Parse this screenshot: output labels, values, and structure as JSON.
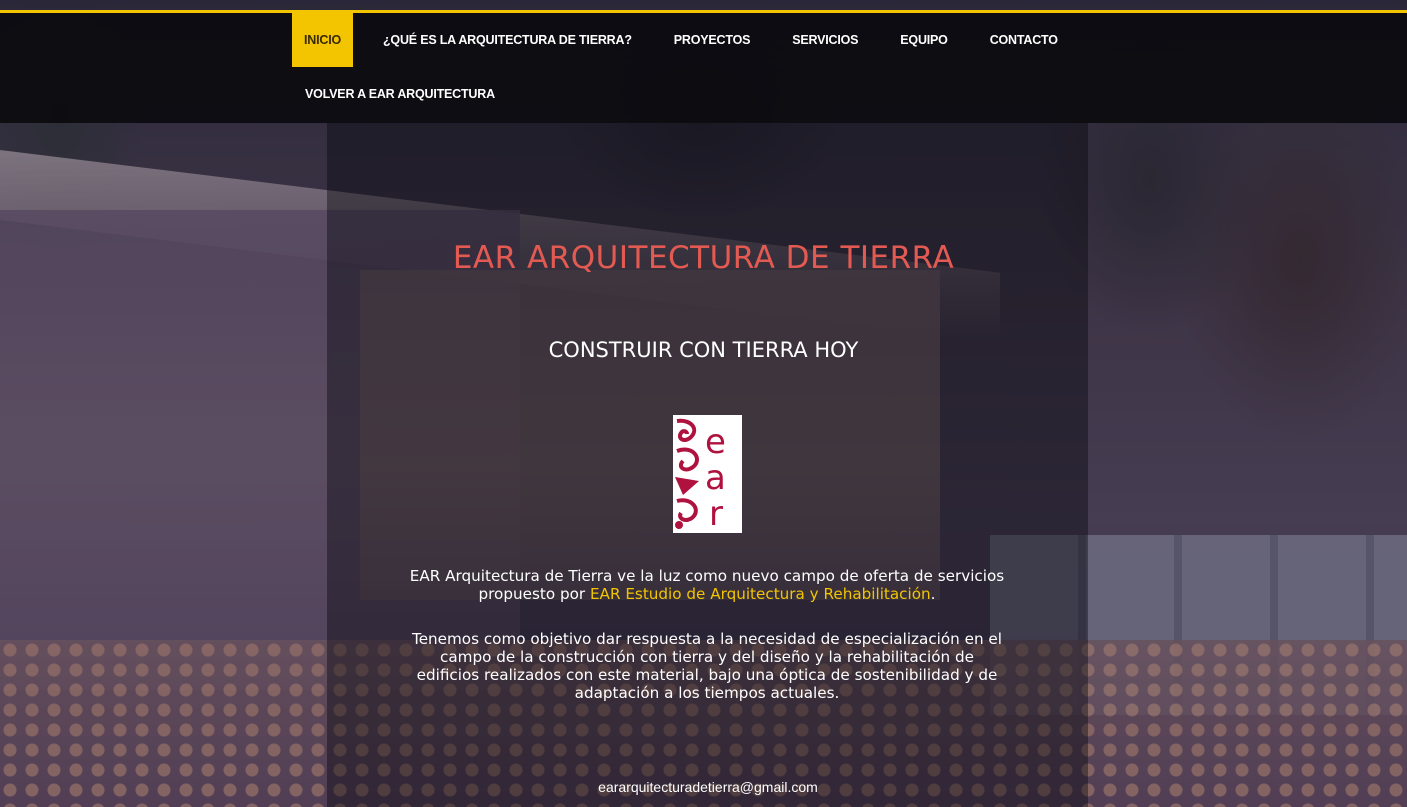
{
  "nav": {
    "items": [
      {
        "label": "INICIO",
        "active": true
      },
      {
        "label": "¿QUÉ ES LA ARQUITECTURA DE TIERRA?"
      },
      {
        "label": "PROYECTOS"
      },
      {
        "label": "SERVICIOS"
      },
      {
        "label": "EQUIPO"
      },
      {
        "label": "CONTACTO"
      }
    ],
    "secondary": "VOLVER A EAR ARQUITECTURA",
    "accent_color": "#f2c500"
  },
  "hero": {
    "title": "EAR ARQUITECTURA DE TIERRA",
    "title_color": "#e25a52",
    "subtitle": "CONSTRUIR CON TIERRA HOY"
  },
  "logo": {
    "icon": "ear-logo",
    "text": "ear",
    "color": "#b0123f"
  },
  "intro": {
    "p1_before": "EAR Arquitectura de Tierra ve la luz como nuevo campo de oferta de servicios propuesto por ",
    "p1_link": "EAR Estudio de Arquitectura y Rehabilitación",
    "p1_after": ".",
    "p2": "Tenemos como objetivo dar respuesta a la necesidad de especialización en el campo de la construcción con tierra y del diseño y la rehabilitación de edificios realizados con este material, bajo una óptica de sostenibilidad y de adaptación a los tiempos actuales."
  },
  "footer": {
    "email": "eararquitecturadetierra@gmail.com"
  }
}
